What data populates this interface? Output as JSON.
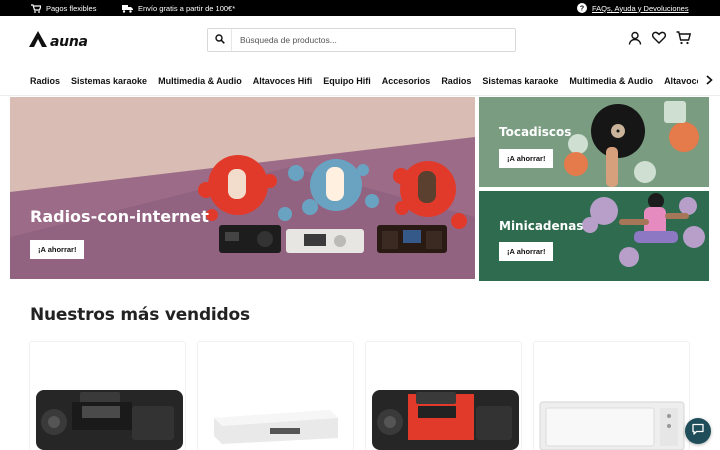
{
  "topbar": {
    "payments": "Pagos flexibles",
    "shipping": "Envío gratis a partir de 100€*",
    "help": "FAQs, Ayuda y Devoluciones"
  },
  "header": {
    "logo_text": "auna",
    "search_placeholder": "Búsqueda de productos..."
  },
  "nav": {
    "items": [
      "Radios",
      "Sistemas karaoke",
      "Multimedia & Audio",
      "Altavoces Hifi",
      "Equipo Hifi",
      "Accesorios",
      "Radios",
      "Sistemas karaoke",
      "Multimedia & Audio",
      "Altavoces Hifi"
    ]
  },
  "banners": {
    "main": {
      "title": "Radios-con-internet",
      "cta": "¡A ahorrar!"
    },
    "turntables": {
      "title": "Tocadiscos",
      "cta": "¡A ahorrar!"
    },
    "minisystems": {
      "title": "Minicadenas",
      "cta": "¡A ahorrar!"
    }
  },
  "bestsellers": {
    "title": "Nuestros más vendidos"
  },
  "colors": {
    "topbar": "#000000",
    "turntables_bg": "#7a9c80",
    "minisystems_bg": "#2f6c4f",
    "accent_red": "#e23a2a",
    "chat": "#1f4e5a"
  }
}
